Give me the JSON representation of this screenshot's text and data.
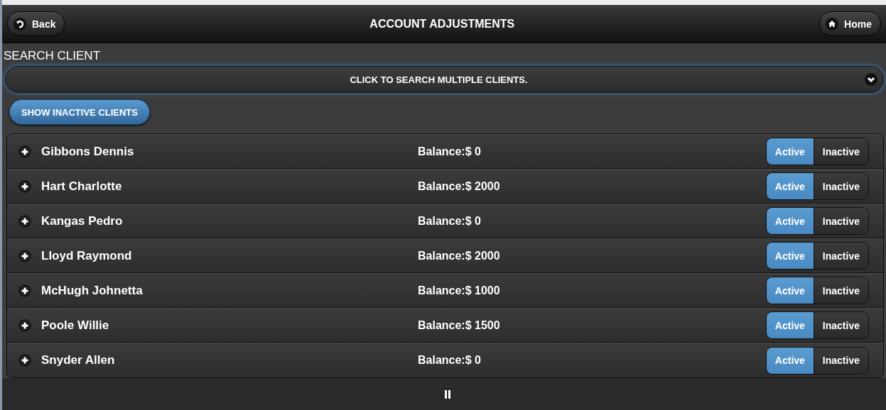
{
  "header": {
    "back": "Back",
    "title": "ACCOUNT ADJUSTMENTS",
    "home": "Home"
  },
  "search": {
    "label": "SEARCH CLIENT",
    "select": "CLICK TO SEARCH MULTIPLE CLIENTS."
  },
  "show_inactive": "SHOW INACTIVE CLIENTS",
  "clients": [
    {
      "name": "Gibbons Dennis",
      "balance": "Balance:$ 0",
      "status": [
        {
          "label": "Active",
          "selected": true
        },
        {
          "label": "Inactive",
          "selected": false
        }
      ]
    },
    {
      "name": "Hart Charlotte",
      "balance": "Balance:$ 2000",
      "status": [
        {
          "label": "Active",
          "selected": true
        },
        {
          "label": "Inactive",
          "selected": false
        }
      ]
    },
    {
      "name": "Kangas Pedro",
      "balance": "Balance:$ 0",
      "status": [
        {
          "label": "Active",
          "selected": true
        },
        {
          "label": "Inactive",
          "selected": false
        }
      ]
    },
    {
      "name": "Lloyd Raymond",
      "balance": "Balance:$ 2000",
      "status": [
        {
          "label": "Active",
          "selected": true
        },
        {
          "label": "Inactive",
          "selected": false
        }
      ]
    },
    {
      "name": "McHugh Johnetta",
      "balance": "Balance:$ 1000",
      "status": [
        {
          "label": "Active",
          "selected": true
        },
        {
          "label": "Inactive",
          "selected": false
        }
      ]
    },
    {
      "name": "Poole Willie",
      "balance": "Balance:$ 1500",
      "status": [
        {
          "label": "Active",
          "selected": true
        },
        {
          "label": "Inactive",
          "selected": false
        }
      ]
    },
    {
      "name": "Snyder Allen",
      "balance": "Balance:$ 0",
      "status": [
        {
          "label": "Active",
          "selected": true
        },
        {
          "label": "Inactive",
          "selected": false
        }
      ]
    }
  ]
}
